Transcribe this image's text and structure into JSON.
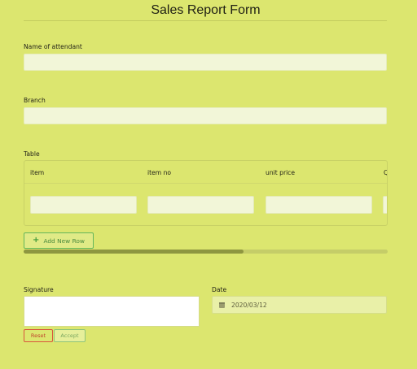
{
  "form": {
    "title": "Sales Report Form"
  },
  "fields": {
    "attendant_label": "Name of attendant",
    "attendant_value": "",
    "branch_label": "Branch",
    "branch_value": "",
    "table_label": "Table",
    "signature_label": "Signature",
    "date_label": "Date",
    "date_value": "2020/03/12"
  },
  "table": {
    "columns": [
      "item",
      "item no",
      "unit price",
      "Q"
    ],
    "rows": [
      [
        "",
        "",
        "",
        ""
      ]
    ],
    "add_row_label": "Add New Row",
    "horizontal_scroll_fraction": 0.605
  },
  "signature": {
    "reset_label": "Reset",
    "accept_label": "Accept"
  },
  "icons": {
    "add_row": "plus-icon",
    "date": "calendar-icon"
  },
  "colors": {
    "background": "#dce66f",
    "input": "#f2f6d8",
    "add_button_border": "#63b65b",
    "reset_border": "#d9553c",
    "accept_border": "#8dc47a"
  }
}
